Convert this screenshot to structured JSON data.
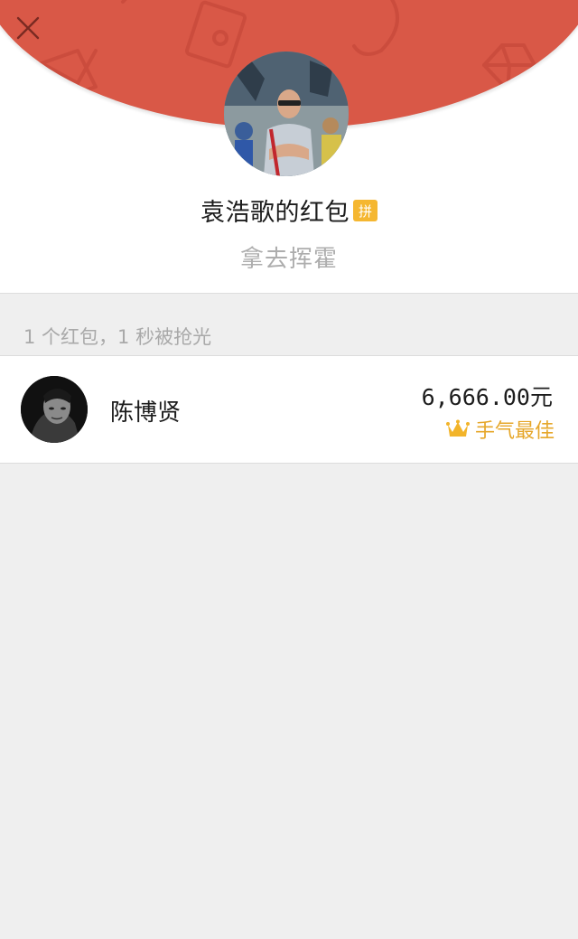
{
  "header": {
    "sender_title": "袁浩歌的红包",
    "pin_badge": "拼",
    "greeting": "拿去挥霍",
    "accent_color": "#d95847",
    "close_icon": "close-icon"
  },
  "summary": {
    "text": "1 个红包，1 秒被抢光"
  },
  "recipients": [
    {
      "name": "陈博贤",
      "amount": "6,666.00元",
      "best_luck_label": "手气最佳",
      "best_luck_icon": "crown-icon",
      "best_luck_color": "#e6a72a"
    }
  ]
}
